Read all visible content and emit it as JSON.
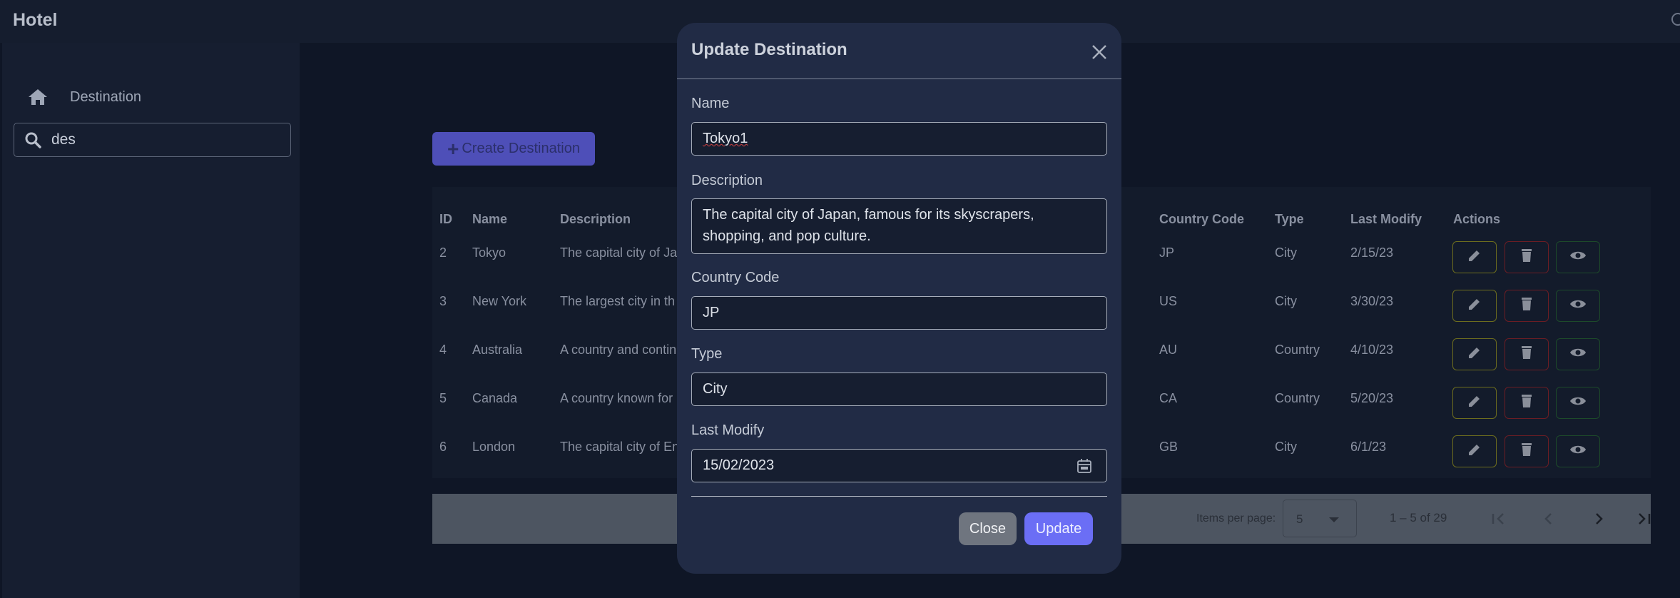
{
  "app": {
    "title": "Hotel"
  },
  "sidebar": {
    "nav": [
      {
        "label": "Destination",
        "icon": "home-icon"
      }
    ],
    "search": {
      "value": "des",
      "icon": "search-icon"
    }
  },
  "toolbar": {
    "create_label": "Create Destination"
  },
  "table": {
    "columns": [
      "ID",
      "Name",
      "Description",
      "Country Code",
      "Type",
      "Last Modify",
      "Actions"
    ],
    "rows": [
      {
        "id": "2",
        "name": "Tokyo",
        "description": "The capital city of Ja",
        "country_code": "JP",
        "type": "City",
        "last_modify": "2/15/23"
      },
      {
        "id": "3",
        "name": "New York",
        "description": "The largest city in th",
        "country_code": "US",
        "type": "City",
        "last_modify": "3/30/23"
      },
      {
        "id": "4",
        "name": "Australia",
        "description": "A country and contin",
        "country_code": "AU",
        "type": "Country",
        "last_modify": "4/10/23"
      },
      {
        "id": "5",
        "name": "Canada",
        "description": "A country known for",
        "country_code": "CA",
        "type": "Country",
        "last_modify": "5/20/23"
      },
      {
        "id": "6",
        "name": "London",
        "description": "The capital city of En",
        "country_code": "GB",
        "type": "City",
        "last_modify": "6/1/23"
      }
    ]
  },
  "paginator": {
    "items_per_page_label": "Items per page:",
    "items_per_page_value": "5",
    "range_label": "1 – 5 of 29"
  },
  "modal": {
    "title": "Update Destination",
    "fields": {
      "name": {
        "label": "Name",
        "value": "Tokyo1"
      },
      "description": {
        "label": "Description",
        "value": "The capital city of Japan, famous for its skyscrapers, shopping, and pop culture."
      },
      "country_code": {
        "label": "Country Code",
        "value": "JP"
      },
      "type": {
        "label": "Type",
        "value": "City"
      },
      "last_modify": {
        "label": "Last Modify",
        "value": "15/02/2023"
      }
    },
    "close_label": "Close",
    "update_label": "Update"
  },
  "colors": {
    "modal_bg": "#212b45",
    "primary": "#6b6ef5",
    "edit_border": "#6d6d1e",
    "delete_border": "#6b1d24",
    "view_border": "#1d4a2a"
  }
}
